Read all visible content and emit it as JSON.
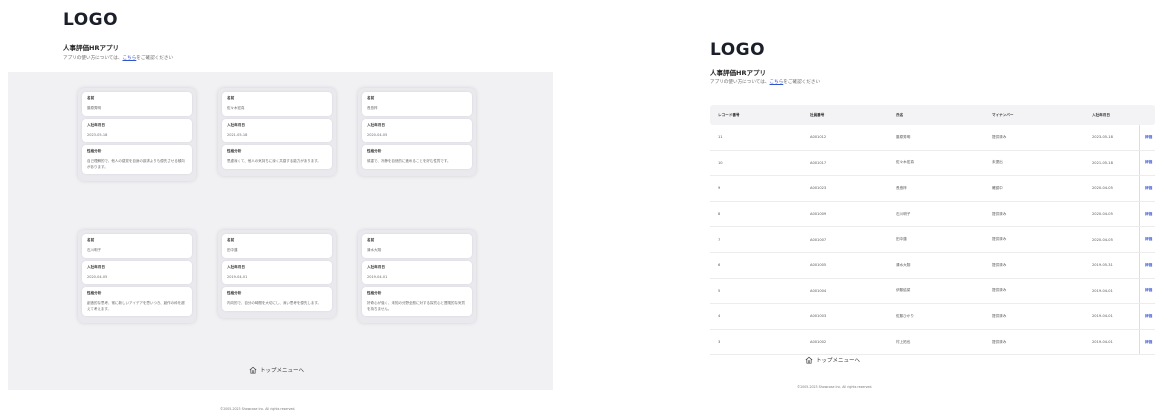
{
  "left": {
    "logo": "LOGO",
    "app_title": "人事評価HRアプリ",
    "subtitle_before": "アプリの使い方については、",
    "subtitle_link": "こちら",
    "subtitle_after": "をご確認ください",
    "labels": {
      "name": "名前",
      "hire_date": "入社年月日",
      "analysis": "性格分析"
    },
    "cards": [
      {
        "name": "藤原秀明",
        "hire_date": "2023-05-18",
        "analysis": "自己理解的で、他人の感覚を自身の欲求よりも優先させる傾向があります。"
      },
      {
        "name": "佐々木宏真",
        "hire_date": "2021-05-18",
        "analysis": "思慮深くて、他人の気持ちに深く共感する能力があります。"
      },
      {
        "name": "長島梓",
        "hire_date": "2020-04-05",
        "analysis": "慎重で、冷静を自然的に進めることを好む性質です。"
      },
      {
        "name": "石川明子",
        "hire_date": "2020-04-05",
        "analysis": "創造的な思考、常に新しいアイデアを思いつき、創作の枠を超えて考えます。"
      },
      {
        "name": "田中蓮",
        "hire_date": "2019-04-01",
        "analysis": "内向的で、自分の時間を大切にし、深い思考を優先します。"
      },
      {
        "name": "清水大翔",
        "hire_date": "2019-04-01",
        "analysis": "好奇心が強く、未知の分野全般に対する探究心と冒険的な気質を持ちません。"
      }
    ],
    "top_menu": "トップメニューへ",
    "copyright": "©2005-2023 Showcase Inc. All rights reserved."
  },
  "right": {
    "logo": "LOGO",
    "app_title": "人事評価HRアプリ",
    "subtitle_before": "アプリの使い方については、",
    "subtitle_link": "こちら",
    "subtitle_after": "をご確認ください",
    "columns": [
      "レコード番号",
      "社員番号",
      "氏名",
      "マイナンバー",
      "入社年月日"
    ],
    "edit_label": "評価",
    "rows": [
      {
        "record": "11",
        "employee_no": "A001012",
        "name": "藤原秀明",
        "mynumber": "提供済み",
        "hire_date": "2023-05-18"
      },
      {
        "record": "10",
        "employee_no": "A001017",
        "name": "佐々木宏真",
        "mynumber": "未提出",
        "hire_date": "2021-05-18"
      },
      {
        "record": "9",
        "employee_no": "A001023",
        "name": "長島梓",
        "mynumber": "確認中",
        "hire_date": "2020-04-05"
      },
      {
        "record": "8",
        "employee_no": "A001009",
        "name": "石川明子",
        "mynumber": "提供済み",
        "hire_date": "2020-04-05"
      },
      {
        "record": "7",
        "employee_no": "A001007",
        "name": "田中蓮",
        "mynumber": "提供済み",
        "hire_date": "2020-04-05"
      },
      {
        "record": "6",
        "employee_no": "A001005",
        "name": "清水大翔",
        "mynumber": "提供済み",
        "hire_date": "2019-05-31"
      },
      {
        "record": "5",
        "employee_no": "A001004",
        "name": "伊藤結菜",
        "mynumber": "提供済み",
        "hire_date": "2019-04-01"
      },
      {
        "record": "4",
        "employee_no": "A001003",
        "name": "佐藤ひかり",
        "mynumber": "提供済み",
        "hire_date": "2019-04-01"
      },
      {
        "record": "3",
        "employee_no": "A001002",
        "name": "村上拓也",
        "mynumber": "提供済み",
        "hire_date": "2019-04-01"
      }
    ],
    "top_menu": "トップメニューへ",
    "copyright": "©2005-2023 Showcase Inc. All rights reserved."
  },
  "colors": {
    "link": "#3355cc",
    "edit": "#3d5bd9",
    "panel_bg": "#f1f1f3"
  },
  "icons": {
    "top_menu": "home-icon"
  }
}
